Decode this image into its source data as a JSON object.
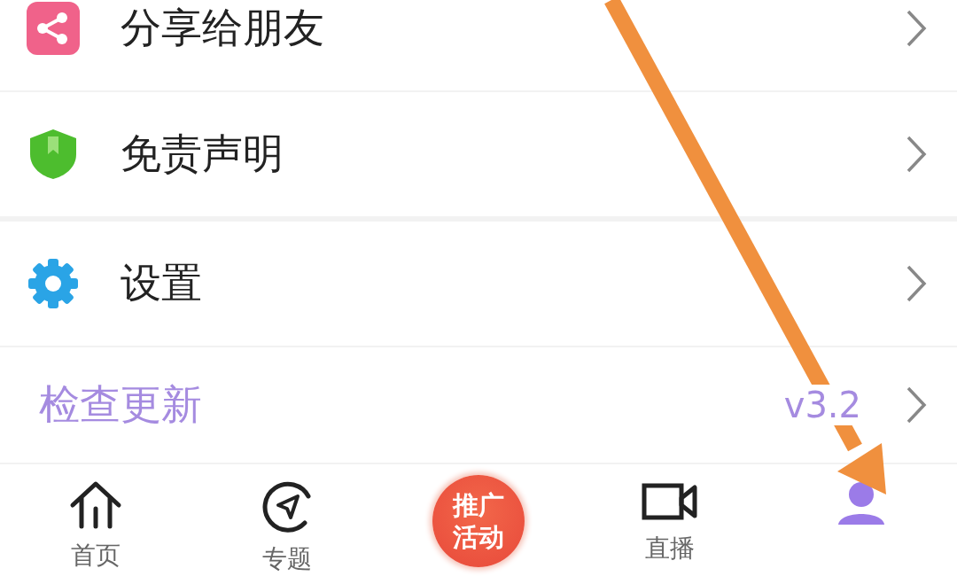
{
  "menu": [
    {
      "kind": "share",
      "label": "分享给朋友"
    },
    {
      "kind": "shield",
      "label": "免责声明"
    },
    {
      "kind": "gear",
      "label": "设置"
    },
    {
      "kind": "update",
      "label": "检查更新",
      "value": "v3.2"
    }
  ],
  "tab_bar": [
    {
      "kind": "home",
      "label": "首页"
    },
    {
      "kind": "compass",
      "label": "专题"
    },
    {
      "kind": "promo",
      "label": "推广活动"
    },
    {
      "kind": "video",
      "label": "直播"
    },
    {
      "kind": "person"
    }
  ]
}
